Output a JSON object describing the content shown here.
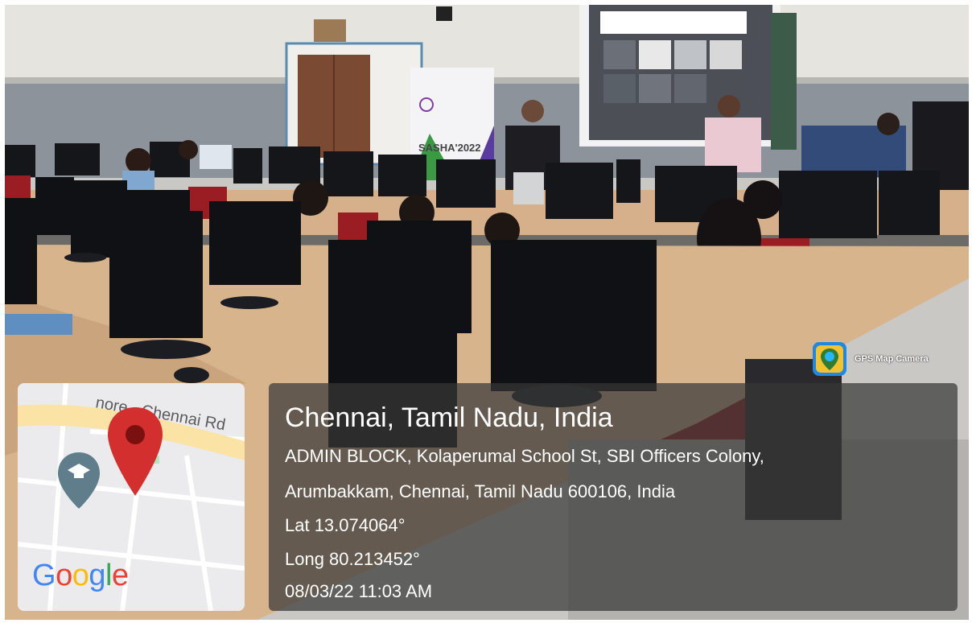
{
  "banner": {
    "text": "SASHA'2022"
  },
  "map": {
    "road_label": "nore - Chennai Rd",
    "logo": "Google",
    "pin_icon": "map-pin-icon",
    "place_icon": "graduation-cap-icon"
  },
  "gps_badge": {
    "label": "GPS Map Camera",
    "icon": "gps-map-camera-icon"
  },
  "location": {
    "title": "Chennai, Tamil Nadu, India",
    "address_line1": "ADMIN BLOCK, Kolaperumal School St, SBI Officers Colony,",
    "address_line2": "Arumbakkam, Chennai, Tamil Nadu 600106, India",
    "lat": "Lat 13.074064°",
    "long": "Long 80.213452°",
    "datetime": "08/03/22 11:03 AM"
  },
  "colors": {
    "pin": "#d32f2f",
    "place_marker": "#607d8b",
    "panel": "#373737"
  }
}
